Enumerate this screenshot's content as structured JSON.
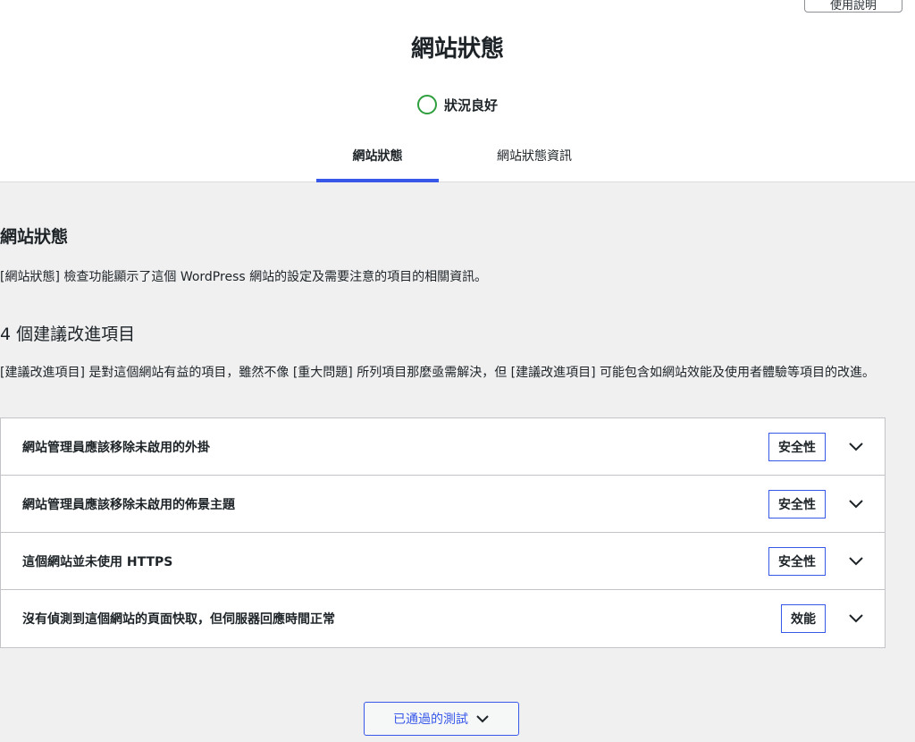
{
  "header": {
    "help_label": "使用說明",
    "title": "網站狀態",
    "status_text": "狀況良好",
    "status_color": "#2e9e3e",
    "tabs": [
      {
        "label": "網站狀態",
        "active": true
      },
      {
        "label": "網站狀態資訊",
        "active": false
      }
    ],
    "accent_color": "#3858e9"
  },
  "main": {
    "section_title": "網站狀態",
    "intro": "[網站狀態] 檢查功能顯示了這個 WordPress 網站的設定及需要注意的項目的相關資訊。",
    "count_title": "4 個建議改進項目",
    "count_desc": "[建議改進項目] 是對這個網站有益的項目，雖然不像 [重大問題] 所列項目那麼亟需解決，但 [建議改進項目] 可能包含如網站效能及使用者體驗等項目的改進。",
    "issues": [
      {
        "label": "網站管理員應該移除未啟用的外掛",
        "badge": "安全性"
      },
      {
        "label": "網站管理員應該移除未啟用的佈景主題",
        "badge": "安全性"
      },
      {
        "label": "這個網站並未使用 HTTPS",
        "badge": "安全性"
      },
      {
        "label": "沒有偵測到這個網站的頁面快取，但伺服器回應時間正常",
        "badge": "效能"
      }
    ],
    "passed_button": "已通過的測試"
  }
}
